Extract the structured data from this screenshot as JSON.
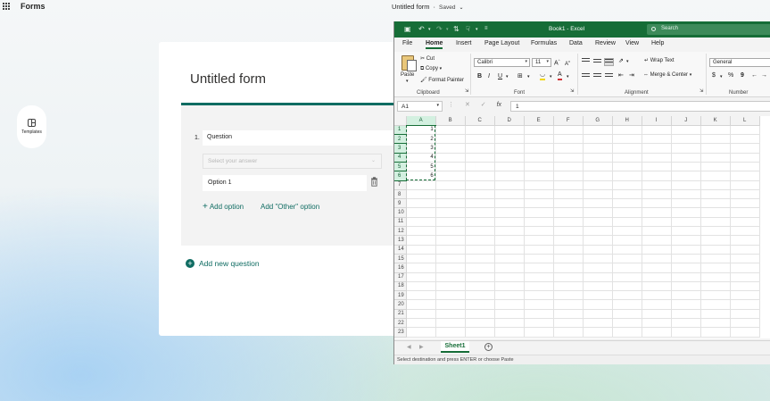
{
  "forms": {
    "brand": "Forms",
    "doc_title": "Untitled form",
    "separator": "·",
    "saved": "Saved",
    "templates_label": "Templates",
    "form_title": "Untitled form",
    "question": {
      "number": "1.",
      "text": "Question",
      "select_placeholder": "Select your answer",
      "option": "Option 1",
      "add_option": "Add option",
      "add_other": "Add \"Other\" option"
    },
    "add_new_question": "Add new question",
    "accent_color": "#0f6c62"
  },
  "excel": {
    "title": "Book1 - Excel",
    "search_placeholder": "Search",
    "brand_color": "#166d37",
    "tabs": [
      "File",
      "Home",
      "Insert",
      "Page Layout",
      "Formulas",
      "Data",
      "Review",
      "View",
      "Help"
    ],
    "active_tab": "Home",
    "ribbon": {
      "paste": "Paste",
      "cut": "Cut",
      "copy": "Copy",
      "format_painter": "Format Painter",
      "clipboard_label": "Clipboard",
      "font_name": "Calibri",
      "font_size": "11",
      "grow_font": "A",
      "shrink_font": "A",
      "bold": "B",
      "italic": "I",
      "underline": "U",
      "font_label": "Font",
      "wrap_text": "Wrap Text",
      "merge_center": "Merge & Center",
      "alignment_label": "Alignment",
      "number_format": "General",
      "currency": "$",
      "percent": "%",
      "comma": "9",
      "number_label": "Number"
    },
    "name_box": "A1",
    "fx": "fx",
    "formula_value": "1",
    "columns": [
      "A",
      "B",
      "C",
      "D",
      "E",
      "F",
      "G",
      "H",
      "I",
      "J",
      "K",
      "L"
    ],
    "rows": [
      "1",
      "2",
      "3",
      "4",
      "5",
      "6",
      "7",
      "8",
      "9",
      "10",
      "11",
      "12",
      "13",
      "14",
      "15",
      "16",
      "17",
      "18",
      "19",
      "20",
      "21",
      "22",
      "23"
    ],
    "cells_A": [
      "1",
      "2",
      "3",
      "4",
      "5",
      "6"
    ],
    "sheet_tab": "Sheet1",
    "status": "Select destination and press ENTER or choose Paste"
  }
}
